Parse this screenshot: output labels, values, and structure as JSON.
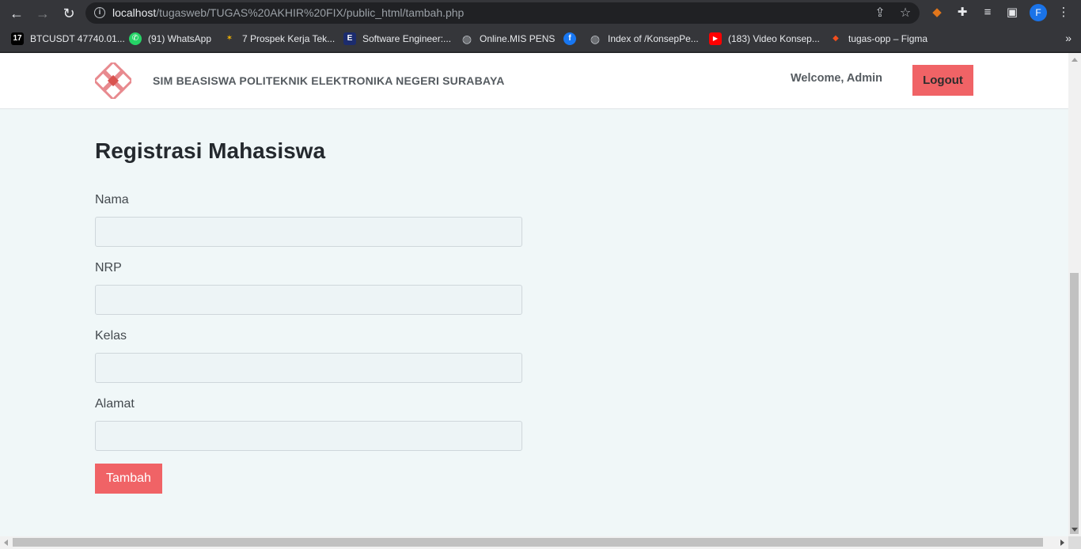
{
  "browser": {
    "url_host": "localhost",
    "url_path": "/tugasweb/TUGAS%20AKHIR%20FIX/public_html/tambah.php",
    "profile_initial": "F",
    "bookmarks": [
      {
        "label": "BTCUSDT 47740.01...",
        "icon": "tradingview-icon",
        "glyph": "17",
        "color": "#000000"
      },
      {
        "label": "(91) WhatsApp",
        "icon": "whatsapp-icon",
        "glyph": "✆",
        "color": "#25d366"
      },
      {
        "label": "7 Prospek Kerja Tek...",
        "icon": "sparkle-icon",
        "glyph": "✶",
        "color": "#3a3a3a"
      },
      {
        "label": "Software Engineer:...",
        "icon": "e-icon",
        "glyph": "E",
        "color": "#1c2c6e"
      },
      {
        "label": "Online.MIS PENS",
        "icon": "globe-icon",
        "glyph": "◍",
        "color": "#5f6368"
      },
      {
        "label": "",
        "icon": "facebook-icon",
        "glyph": "f",
        "color": "#1877f2"
      },
      {
        "label": "Index of /KonsepPe...",
        "icon": "globe-icon",
        "glyph": "◍",
        "color": "#5f6368"
      },
      {
        "label": "(183) Video Konsep...",
        "icon": "youtube-icon",
        "glyph": "▶",
        "color": "#ff0000"
      },
      {
        "label": "tugas-opp – Figma",
        "icon": "figma-icon",
        "glyph": "◆",
        "color": "#a259ff"
      }
    ]
  },
  "header": {
    "site_title": "SIM BEASISWA POLITEKNIK ELEKTRONIKA NEGERI SURABAYA",
    "welcome": "Welcome, Admin",
    "logout_label": "Logout"
  },
  "form": {
    "heading": "Registrasi Mahasiswa",
    "fields": [
      {
        "label": "Nama",
        "value": ""
      },
      {
        "label": "NRP",
        "value": ""
      },
      {
        "label": "Kelas",
        "value": ""
      },
      {
        "label": "Alamat",
        "value": ""
      }
    ],
    "submit_label": "Tambah"
  },
  "colors": {
    "accent": "#f06366",
    "page_bg": "#f0f7f8",
    "header_bg": "#ffffff"
  }
}
